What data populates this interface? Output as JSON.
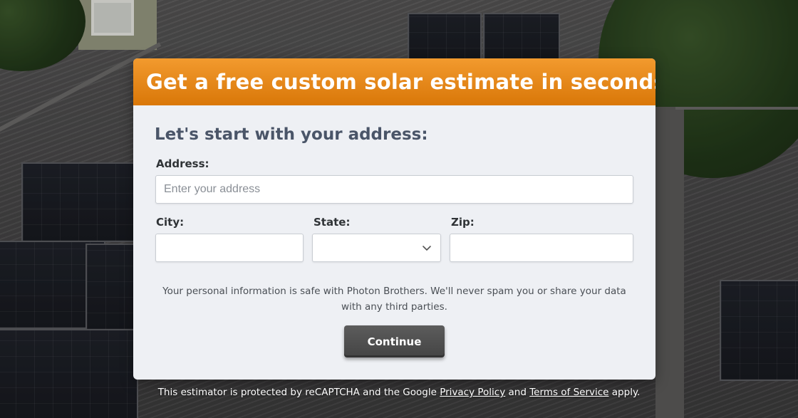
{
  "header": {
    "title": "Get a free custom solar estimate in seconds."
  },
  "form": {
    "heading": "Let's start with your address:",
    "address": {
      "label": "Address:",
      "placeholder": "Enter your address",
      "value": ""
    },
    "city": {
      "label": "City:",
      "value": ""
    },
    "state": {
      "label": "State:",
      "selected": "",
      "icon": "chevron-down-icon"
    },
    "zip": {
      "label": "Zip:",
      "value": ""
    },
    "privacy_note": "Your personal information is safe with Photon Brothers. We'll never spam you or share your data with any third parties.",
    "continue_label": "Continue"
  },
  "footer": {
    "text_before": "This estimator is protected by reCAPTCHA and the Google",
    "privacy_link": "Privacy Policy",
    "text_and": "and",
    "terms_link": "Terms of Service",
    "text_after": "apply."
  },
  "colors": {
    "header_gradient_top": "#f29a2e",
    "header_gradient_bottom": "#d97708",
    "card_background": "#eef0f4",
    "heading_text": "#4a5568",
    "button_background": "#4f4f4f"
  }
}
